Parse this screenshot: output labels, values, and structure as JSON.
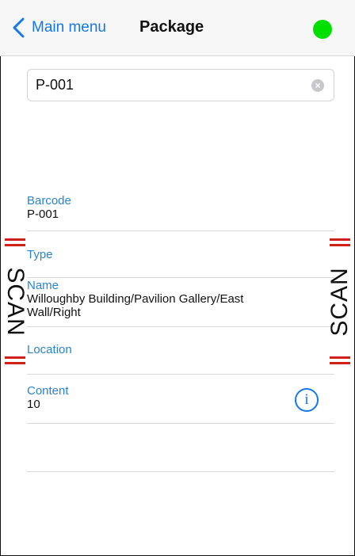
{
  "nav": {
    "back_label": "Main menu",
    "title": "Package",
    "status_color": "#00e000"
  },
  "search": {
    "value": "P-001"
  },
  "fields": {
    "barcode": {
      "label": "Barcode",
      "value": "P-001"
    },
    "type": {
      "label": "Type",
      "value": ""
    },
    "name": {
      "label": "Name",
      "value_line1": "Willoughby Building/Pavilion Gallery/East",
      "value_line2": "Wall/Right"
    },
    "location": {
      "label": "Location",
      "value": ""
    },
    "content": {
      "label": "Content",
      "value": "10"
    }
  },
  "scan_button": {
    "left_label": "SCAN",
    "right_label": "SCAN",
    "accent_color": "#d31e1e"
  },
  "icons": {
    "back": "chevron-left-icon",
    "clear": "clear-icon",
    "info": "info-icon",
    "status": "status-dot"
  }
}
